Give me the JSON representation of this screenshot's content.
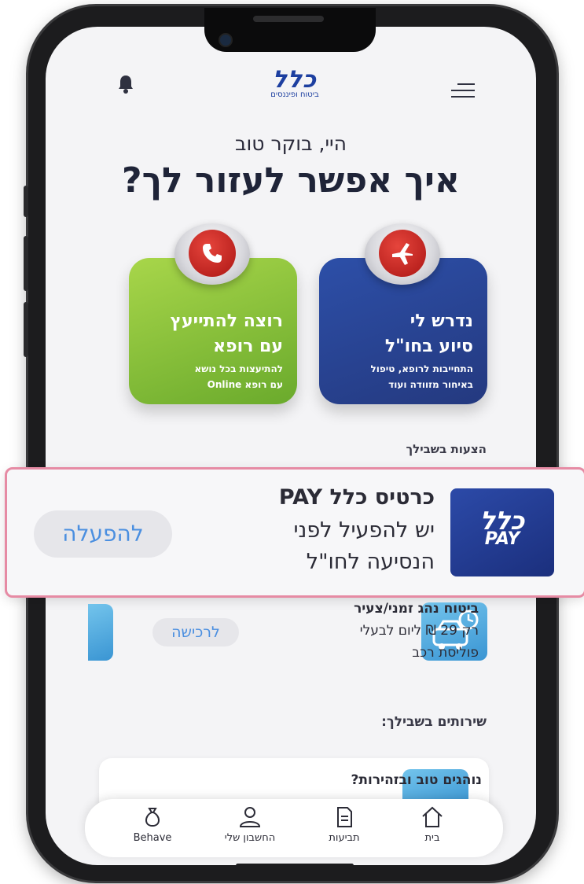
{
  "header": {
    "logo_main": "כלל",
    "logo_sub": "ביטוח ופיננסים"
  },
  "greeting": "היי, בוקר טוב",
  "headline": "איך אפשר לעזור לך?",
  "cards": {
    "abroad": {
      "title1": "נדרש לי",
      "title2": "סיוע בחו\"ל",
      "sub1": "התחייבות לרופא, טיפול",
      "sub2": "באיחור מזוודה ועוד",
      "icon": "airplane-icon"
    },
    "doctor": {
      "title1": "רוצה להתייעץ",
      "title2": "עם רופא",
      "sub1": "להתיעצות בכל נושא",
      "sub2": "עם רופא Online",
      "icon": "phone-icon"
    }
  },
  "suggestions_title": "הצעות בשבילך",
  "promo": {
    "logo_main": "כלל",
    "logo_sub": "PAY",
    "title": "כרטיס כלל PAY",
    "line1": "יש להפעיל לפני",
    "line2": "הנסיעה לחו\"ל",
    "button": "להפעלה"
  },
  "offer": {
    "title": "ביטוח נהג זמני/צעיר",
    "line1": "רק 29 ₪ ליום לבעלי",
    "line2": "פוליסת רכב",
    "button": "לרכישה"
  },
  "services_title": "שירותים בשבילך:",
  "service_card": {
    "title": "נוהגים טוב ובזהירות?"
  },
  "nav": [
    {
      "label": "בית",
      "icon": "home-icon"
    },
    {
      "label": "תביעות",
      "icon": "document-icon"
    },
    {
      "label": "החשבון שלי",
      "icon": "user-icon"
    },
    {
      "label": "Behave",
      "icon": "money-bag-icon"
    }
  ],
  "colors": {
    "brand_blue": "#24397f",
    "green": "#6aaa2c",
    "red": "#b71f1c",
    "link_blue": "#4b8fe0",
    "highlight_border": "#e68ba4"
  }
}
